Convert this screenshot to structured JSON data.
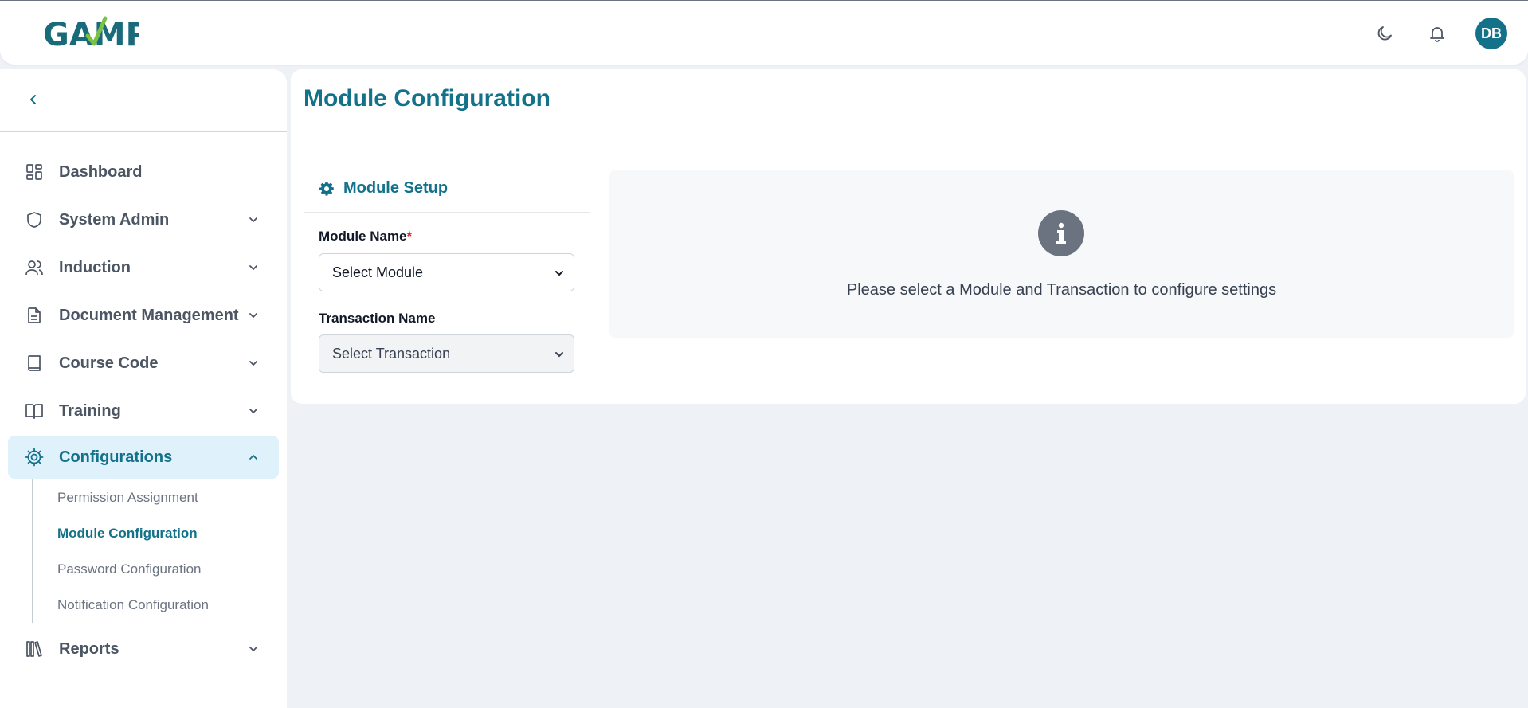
{
  "header": {
    "logo_text": "GAMP",
    "avatar_initials": "DB",
    "icons": [
      "moon-icon",
      "bell-icon"
    ],
    "accent_color": "#13718a"
  },
  "sidebar": {
    "items": [
      {
        "label": "Dashboard",
        "icon": "dashboard-icon",
        "expandable": false
      },
      {
        "label": "System Admin",
        "icon": "shield-icon",
        "expandable": true
      },
      {
        "label": "Induction",
        "icon": "users-icon",
        "expandable": true
      },
      {
        "label": "Document Management",
        "icon": "document-icon",
        "expandable": true
      },
      {
        "label": "Course Code",
        "icon": "book-icon",
        "expandable": true
      },
      {
        "label": "Training",
        "icon": "open-book-icon",
        "expandable": true
      },
      {
        "label": "Configurations",
        "icon": "cog-icon",
        "expandable": true,
        "expanded": true,
        "active": true
      },
      {
        "label": "Reports",
        "icon": "library-icon",
        "expandable": true
      }
    ],
    "configurations_submenu": [
      {
        "label": "Permission Assignment",
        "active": false
      },
      {
        "label": "Module Configuration",
        "active": true
      },
      {
        "label": "Password Configuration",
        "active": false
      },
      {
        "label": "Notification Configuration",
        "active": false
      }
    ]
  },
  "main": {
    "title": "Module Configuration",
    "setup": {
      "title": "Module Setup",
      "module_label": "Module Name",
      "required_mark": "*",
      "module_selected": "Select Module",
      "transaction_label": "Transaction Name",
      "transaction_selected": "Select Transaction"
    },
    "info_message": "Please select a Module and Transaction to configure settings"
  }
}
